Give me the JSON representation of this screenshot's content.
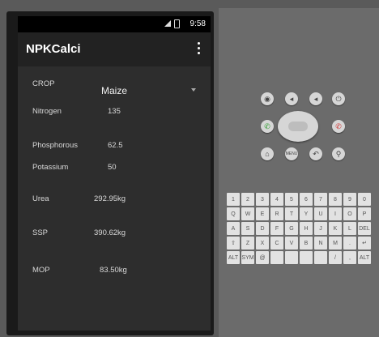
{
  "status": {
    "time": "9:58"
  },
  "app": {
    "title": "NPKCalci"
  },
  "form": {
    "crop_label": "CROP",
    "crop_value": "Maize",
    "nitrogen_label": "Nitrogen",
    "nitrogen_value": "135",
    "phosphorous_label": "Phosphorous",
    "phosphorous_value": "62.5",
    "potassium_label": "Potassium",
    "potassium_value": "50"
  },
  "results": {
    "urea_label": "Urea",
    "urea_value": "292.95kg",
    "ssp_label": "SSP",
    "ssp_value": "390.62kg",
    "mop_label": "MOP",
    "mop_value": "83.50kg"
  },
  "controls": {
    "menu_label": "MENU",
    "keyboard_rows": [
      [
        "1",
        "2",
        "3",
        "4",
        "5",
        "6",
        "7",
        "8",
        "9",
        "0"
      ],
      [
        "Q",
        "W",
        "E",
        "R",
        "T",
        "Y",
        "U",
        "I",
        "O",
        "P"
      ],
      [
        "A",
        "S",
        "D",
        "F",
        "G",
        "H",
        "J",
        "K",
        "L",
        "DEL"
      ],
      [
        "⇧",
        "Z",
        "X",
        "C",
        "V",
        "B",
        "N",
        "M",
        ".",
        "↵"
      ],
      [
        "ALT",
        "SYM",
        "@",
        "",
        "",
        "",
        "",
        "/",
        ",",
        "ALT"
      ]
    ]
  }
}
